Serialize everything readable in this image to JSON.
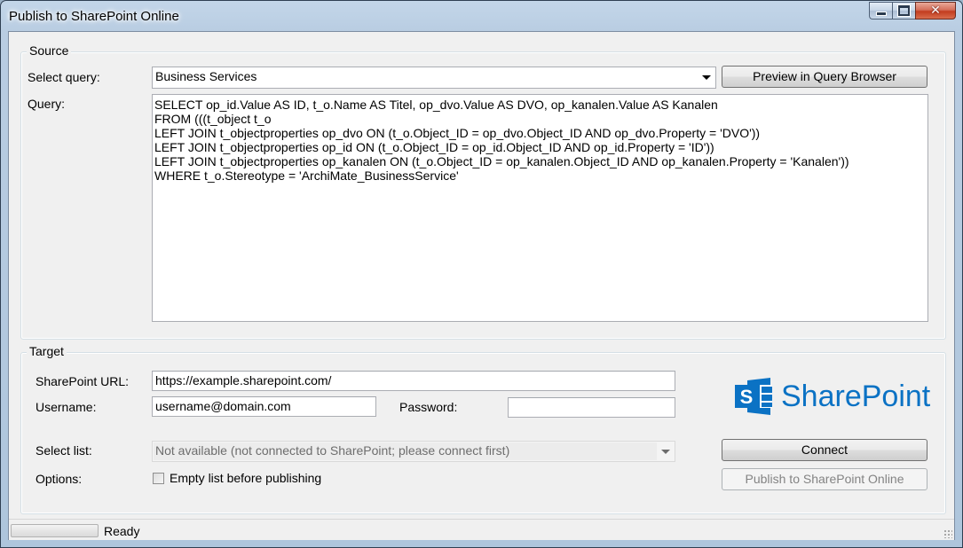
{
  "window": {
    "title": "Publish to SharePoint Online",
    "controls": {
      "minimize_icon": "minimize-icon",
      "maximize_icon": "maximize-icon",
      "close_icon": "close-icon",
      "close_glyph": "✕"
    }
  },
  "source": {
    "group_label": "Source",
    "select_query_label": "Select query:",
    "select_query_value": "Business Services",
    "preview_button": "Preview in Query Browser",
    "query_label": "Query:",
    "query_text": "SELECT op_id.Value AS ID, t_o.Name AS Titel, op_dvo.Value AS DVO, op_kanalen.Value AS Kanalen\nFROM (((t_object t_o\nLEFT JOIN t_objectproperties op_dvo ON (t_o.Object_ID = op_dvo.Object_ID AND op_dvo.Property = 'DVO'))\nLEFT JOIN t_objectproperties op_id ON (t_o.Object_ID = op_id.Object_ID AND op_id.Property = 'ID'))\nLEFT JOIN t_objectproperties op_kanalen ON (t_o.Object_ID = op_kanalen.Object_ID AND op_kanalen.Property = 'Kanalen'))\nWHERE t_o.Stereotype = 'ArchiMate_BusinessService'"
  },
  "target": {
    "group_label": "Target",
    "url_label": "SharePoint URL:",
    "url_value": "https://example.sharepoint.com/",
    "username_label": "Username:",
    "username_value": "username@domain.com",
    "password_label": "Password:",
    "password_value": "",
    "select_list_label": "Select list:",
    "select_list_value": "Not available (not connected to SharePoint; please connect first)",
    "options_label": "Options:",
    "empty_list_checkbox_label": "Empty list before publishing",
    "empty_list_checked": false,
    "connect_button": "Connect",
    "publish_button": "Publish to SharePoint Online",
    "logo_text": "SharePoint",
    "logo_icon": "sharepoint-logo-icon",
    "brand_color": "#0b72c4"
  },
  "statusbar": {
    "progress": 0,
    "status_text": "Ready"
  }
}
